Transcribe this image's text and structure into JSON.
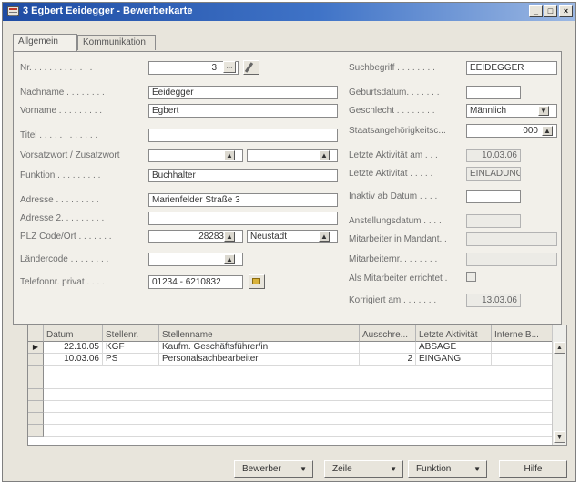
{
  "window": {
    "title": "3 Egbert Eeidegger - Bewerberkarte"
  },
  "tabs": [
    "Allgemein",
    "Kommunikation"
  ],
  "left": {
    "nr_label": "Nr. . . . . . . . . . . . .",
    "nr_value": "3",
    "nachname_label": "Nachname . . . . . . . .",
    "nachname_value": "Eeidegger",
    "vorname_label": "Vorname . . . . . . . . .",
    "vorname_value": "Egbert",
    "titel_label": "Titel . . . . . . . . . . . .",
    "titel_value": "",
    "vorsatz_label": "Vorsatzwort / Zusatzwort",
    "funktion_label": "Funktion . . . . . . . . .",
    "funktion_value": "Buchhalter",
    "adresse_label": "Adresse . . . . . . . . .",
    "adresse_value": "Marienfelder Straße 3",
    "adresse2_label": "Adresse 2. . . . . . . . .",
    "adresse2_value": "",
    "plz_label": "PLZ Code/Ort . . . . . . .",
    "plz_value": "28283",
    "ort_value": "Neustadt",
    "laender_label": "Ländercode . . . . . . . .",
    "laender_value": "",
    "telefon_label": "Telefonnr. privat . . . .",
    "telefon_value": "01234 - 6210832"
  },
  "right": {
    "such_label": "Suchbegriff . . . . . . . .",
    "such_value": "EEIDEGGER",
    "geb_label": "Geburtsdatum. . . . . . .",
    "geb_value": "",
    "geschl_label": "Geschlecht . . . . . . . .",
    "geschl_value": "Männlich",
    "staat_label": "Staatsangehörigkeitsc...",
    "staat_value": "000",
    "letzte_dat_label": "Letzte Aktivität am . . .",
    "letzte_dat_value": "10.03.06",
    "letzte_akt_label": "Letzte Aktivität . . . . .",
    "letzte_akt_value": "EINLADUNG",
    "inaktiv_label": "Inaktiv ab Datum . . . .",
    "inaktiv_value": "",
    "anst_label": "Anstellungsdatum . . . .",
    "anst_value": "",
    "mitmand_label": "Mitarbeiter in Mandant. .",
    "mitmand_value": "",
    "mitnr_label": "Mitarbeiternr. . . . . . . .",
    "mitnr_value": "",
    "errichtet_label": "Als Mitarbeiter errichtet .",
    "korr_label": "Korrigiert am . . . . . . .",
    "korr_value": "13.03.06"
  },
  "grid": {
    "headers": [
      "Datum",
      "Stellenr.",
      "Stellenname",
      "Ausschre...",
      "Letzte Aktivität",
      "Interne B..."
    ],
    "rows": [
      {
        "datum": "22.10.05",
        "stellenr": "KGF",
        "stellenname": "Kaufm. Geschäftsführer/in",
        "ausschr": "",
        "letzte": "ABSAGE",
        "interne": ""
      },
      {
        "datum": "10.03.06",
        "stellenr": "PS",
        "stellenname": "Personalsachbearbeiter",
        "ausschr": "2",
        "letzte": "EINGANG",
        "interne": ""
      }
    ]
  },
  "footer": {
    "bewerber": "Bewerber",
    "zeile": "Zeile",
    "funktion": "Funktion",
    "hilfe": "Hilfe"
  },
  "icons": {
    "window": "table-icon",
    "lookup": "lookup-arrow-icon",
    "edit": "pencil-icon",
    "phone": "dial-phone-icon",
    "dropdown": "chevron-down-icon",
    "selector": "row-selector-triangle-icon"
  },
  "colors": {
    "titlebar": "#2a5aad",
    "background": "#e8e5dc"
  }
}
